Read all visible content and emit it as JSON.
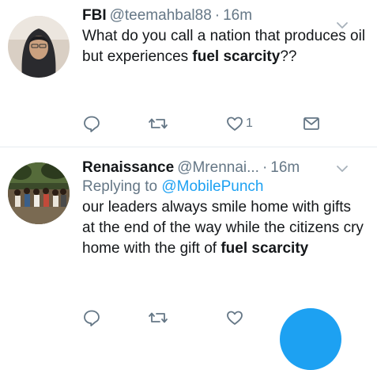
{
  "tweets": [
    {
      "name": "FBI",
      "handle": "@teemahbal88",
      "dot": "·",
      "time": "16m",
      "text_before": "What do you call a nation that produces oil but experiences ",
      "text_bold": "fuel scarcity",
      "text_after": "??",
      "like_count": "1"
    },
    {
      "name": "Renaissance",
      "handle": "@Mrennai...",
      "dot": "·",
      "time": "16m",
      "replying_prefix": "Replying to ",
      "replying_to": "@MobilePunch",
      "text_before": "our leaders always smile home with gifts at the end of the way while the citizens cry home with the gift of ",
      "text_bold": "fuel scarcity",
      "text_after": "",
      "like_count": ""
    }
  ],
  "icons": {
    "reply": "reply-icon",
    "retweet": "retweet-icon",
    "like": "heart-icon",
    "dm": "envelope-icon",
    "menu": "chevron-down-icon"
  },
  "colors": {
    "accent": "#1da1f2",
    "secondary_text": "#657786",
    "primary_text": "#14171a",
    "divider": "#e6ecf0"
  }
}
